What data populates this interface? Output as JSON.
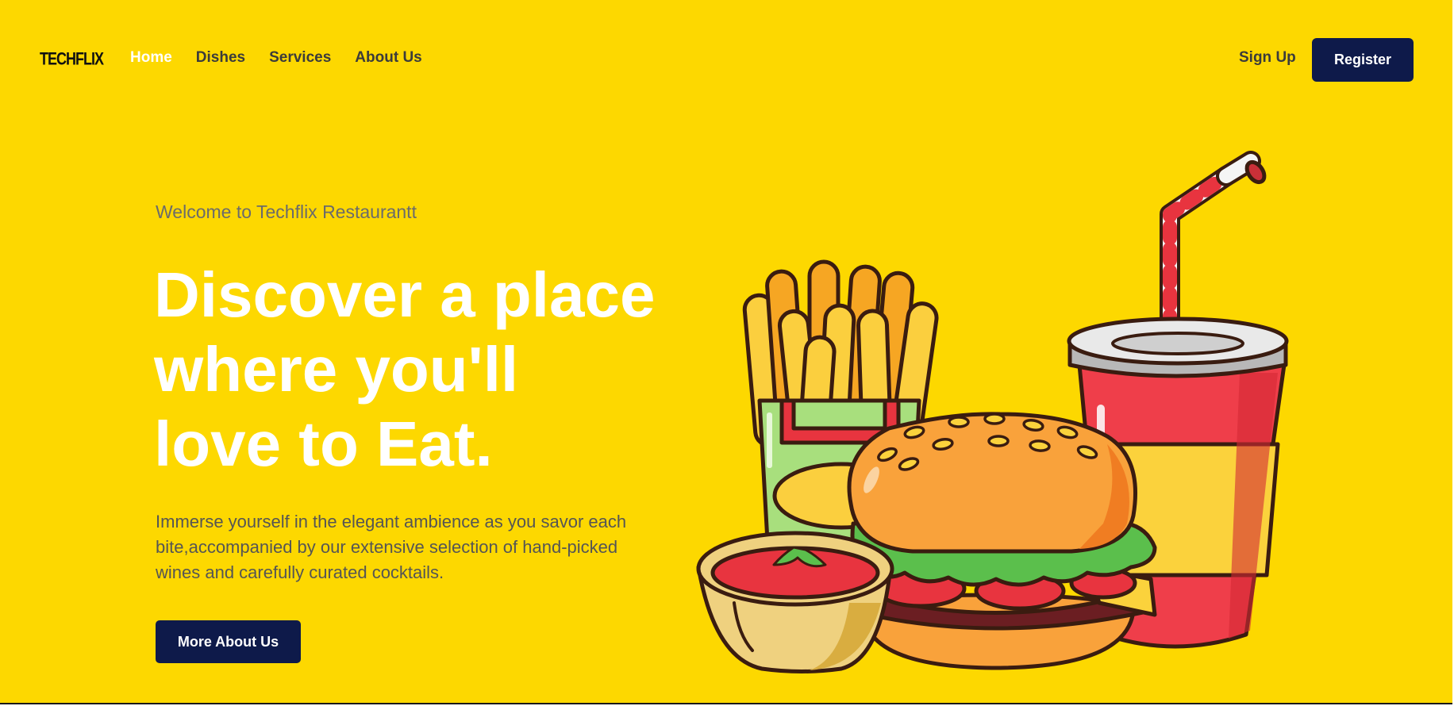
{
  "brand": {
    "logo_text": "TECHFLIX"
  },
  "nav": {
    "items": [
      {
        "label": "Home",
        "active": true
      },
      {
        "label": "Dishes",
        "active": false
      },
      {
        "label": "Services",
        "active": false
      },
      {
        "label": "About Us",
        "active": false
      }
    ],
    "signup_label": "Sign Up",
    "register_label": "Register"
  },
  "hero": {
    "welcome": "Welcome to Techflix Restaurantt",
    "headline_lines": [
      "Discover a place",
      "where you'll",
      "love to Eat."
    ],
    "description": "Immerse yourself in the elegant ambience as you savor each bite,accompanied by our extensive selection of hand-picked wines and carefully curated cocktails.",
    "cta_label": "More About Us"
  },
  "illustration": {
    "icons": [
      "fries-icon",
      "burger-icon",
      "soda-cup-icon",
      "sauce-bowl-icon"
    ]
  },
  "colors": {
    "background": "#fdd800",
    "primary_button": "#0e1a4a",
    "headline": "#ffffff",
    "nav_text": "#3b3b3b"
  }
}
